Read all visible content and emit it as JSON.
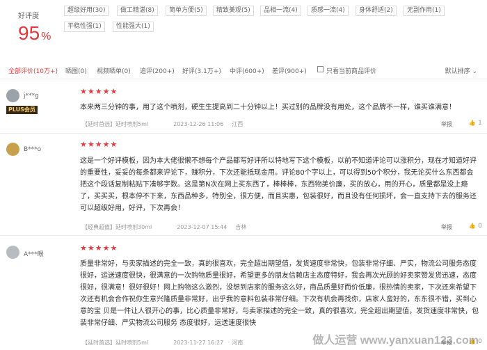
{
  "summary": {
    "rate_label": "好评度",
    "rate_value": "95",
    "rate_unit": "%"
  },
  "tags": [
    "超级好用(30)",
    "做工精湛(8)",
    "简单方便(5)",
    "精致美观(5)",
    "品相一流(4)",
    "质感一流(4)",
    "身体舒适(2)",
    "无副作用(1)",
    "平稳性强(1)",
    "性能强大(1)"
  ],
  "filters": {
    "items": [
      "全部评价(10万+)",
      "晒图(0)",
      "视频晒单(0)",
      "追评(200+)",
      "好评(3.1万+)",
      "中评(600+)",
      "差评(900+)"
    ],
    "only_current_label": "只看当前商品评价",
    "sort_label": "默认排序",
    "sort_arrow": "⌄"
  },
  "reviews": [
    {
      "username": "j***g",
      "badge": "PLUS会员",
      "stars": "★★★★★",
      "content": "本来两三分钟的事，用了这个喷剂，硬生生提高到二十分钟以上！买过别的品牌没有用处，这个品牌不一样，谁买谁满意！",
      "tag": "【延时首选】",
      "spec": "延时喷剂5ml",
      "time": "2023-12-26 11:06",
      "location": "江西",
      "report": "举报",
      "likes": "1",
      "avatar_color": "#9aa3a8"
    },
    {
      "username": "B***o",
      "badge": "",
      "stars": "★★★★★",
      "content": "这是一个好评模板，因为本大佬很懒不想每个产品都写好评所以特地写下这个模板，以前不知道评论可以涨积分，现在才知道好评的重要性，妥妥的每条都来评论下，赚积分，下次还能抵现金用。评论80个字以上，可以得到50个积分，我无论买什么东西都会把这个段话复制粘贴下凑够字数。这是第N次在网上买东西了，棒棒棒，东西物美价廉，买的放心，用的开心，质量都是没上瘾了，买买买，根本停不下来，东西品种多，特别全，很方便，而且实惠，包装很好，而且没有任何损坏，会一直支持下去的服务还可以超级好用，好评，下次再会！",
      "tag": "【经典超值】",
      "spec": "延时喷剂30ml",
      "time": "2023-12-07 15:44",
      "location": "吉林",
      "report": "举报",
      "likes": "0",
      "avatar_color": "#c7a04a"
    },
    {
      "username": "A***眼",
      "badge": "",
      "stars": "★★★★★",
      "content": "质量非常好，与卖家描述的完全一致，真的很喜欢，完全超出期望值，发货速度非常快，包装非常仔细、严实，物流公司服务态度很好，运送速度很快，很满意的一次购物质量很好，希望更多的朋友信赖店主态度特好，我会再次光顾的好卖家赞发货迅速，态度很好，很满意！很好很好！网上购物这么激烈，没想到店家的服务这么好，商品质量好而价低廉，很热情的卖家，下次还来希望下次还有机会合作祝你生意兴隆质量非常好，出乎我的意料包装非常仔细。下次有机会再找你，店家人蛮好的，东东很不错，买到心意的宝 贝是一件让人很开心的事，比心质量非常好，与卖家描述的完全一致，真的很喜欢，完全超出期望值，发货速度非常快，包装非常仔细、严实物流公司服务 态度很好，运送速度很快",
      "tag": "【延时首选】",
      "spec": "延时喷剂5ml",
      "time": "2023-11-27 16:27",
      "location": "河南",
      "report": "举报",
      "likes": "0",
      "avatar_color": "#b8bcc0"
    }
  ],
  "watermark": "做人运营 www.yanxuan123.com"
}
